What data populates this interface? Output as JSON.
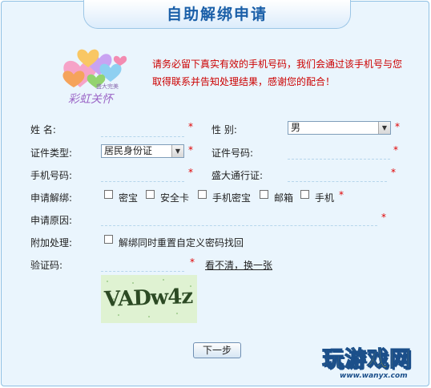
{
  "page": {
    "title": "自助解绑申请",
    "notice_line1": "请务必留下真实有效的手机号码，我们会通过该手机号与您",
    "notice_line2": "取得联系并告知处理结果，感谢您的配合！",
    "required_mark": "*"
  },
  "logo": {
    "subtitle": "盛大完美",
    "name": "彩虹关怀"
  },
  "form": {
    "name_label": "姓 名:",
    "gender_label": "性 别:",
    "gender_value": "男",
    "id_type_label": "证件类型:",
    "id_type_value": "居民身份证",
    "id_number_label": "证件号码:",
    "phone_label": "手机号码:",
    "pass_label": "盛大通行证:",
    "unbind_label": "申请解绑:",
    "unbind_options": [
      "密宝",
      "安全卡",
      "手机密宝",
      "邮箱",
      "手机"
    ],
    "reason_label": "申请原因:",
    "extra_label": "附加处理:",
    "extra_option": "解绑同时重置自定义密码找回",
    "captcha_label": "验证码:",
    "refresh_link": "看不清，换一张",
    "captcha_text": "VADw4z",
    "next_button": "下一步"
  },
  "watermark": {
    "main": "玩游戏网",
    "url": "www.wanyx.com"
  },
  "colors": {
    "accent": "#1a5fa8",
    "required": "#e00000",
    "notice": "#cc0000"
  }
}
